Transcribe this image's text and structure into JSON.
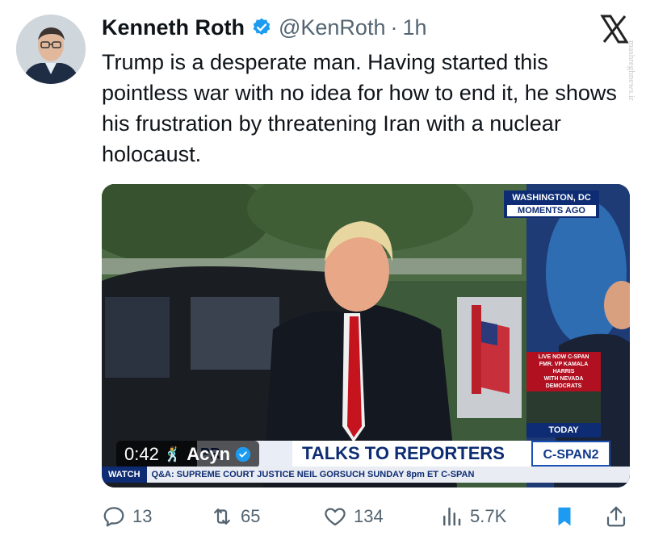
{
  "author": {
    "name": "Kenneth Roth",
    "handle": "@KenRoth",
    "separator": "·",
    "time": "1h"
  },
  "platform": {
    "logo_icon": "x-logo-icon",
    "watermark": "mashreghnews.ir"
  },
  "tweet": {
    "text": "Trump is a desperate man. Having started this pointless war with no idea for how to end it, he shows his frustration by threatening Iran with a nuclear holocaust."
  },
  "media": {
    "duration": "0:42",
    "credit": "Acyn",
    "location_top": "WASHINGTON, DC",
    "location_bottom": "MOMENTS AGO",
    "live_lines": [
      "LIVE NOW C-SPAN",
      "FMR. VP KAMALA HARRIS",
      "WITH NEVADA DEMOCRATS"
    ],
    "today": "TODAY",
    "chyron_left": "PR",
    "chyron_main": "TALKS TO REPORTERS",
    "network": "C-SPAN2",
    "ticker_tag": "WATCH",
    "ticker_text": "Q&A: SUPREME COURT JUSTICE NEIL GORSUCH  SUNDAY 8pm ET  C-SPAN"
  },
  "actions": {
    "replies": "13",
    "reposts": "65",
    "likes": "134",
    "views": "5.7K"
  },
  "colors": {
    "text": "#0f1419",
    "muted": "#536471",
    "verified": "#1d9bf0",
    "bookmark": "#1d9bf0",
    "cspan_blue": "#0d2c73"
  }
}
